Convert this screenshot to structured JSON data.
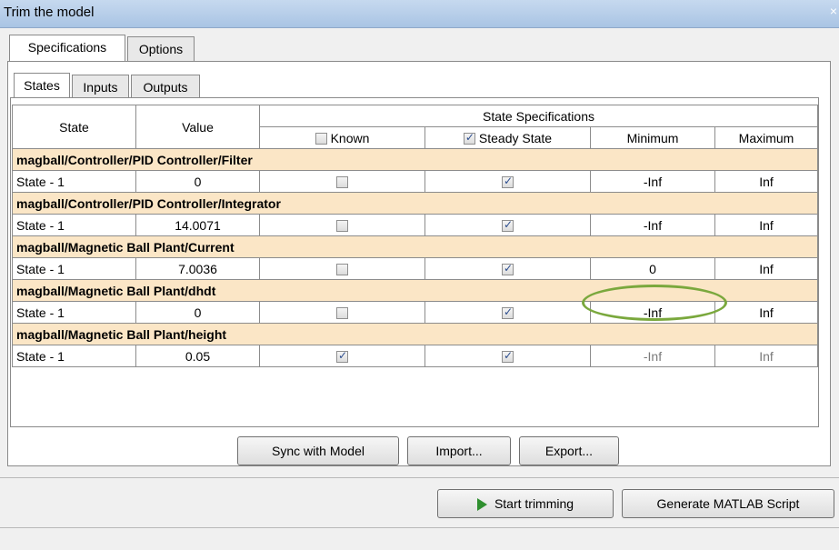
{
  "window": {
    "title": "Trim the model",
    "close_glyph": "×"
  },
  "outer_tabs": [
    "Specifications",
    "Options"
  ],
  "inner_tabs": [
    "States",
    "Inputs",
    "Outputs"
  ],
  "table": {
    "headers": {
      "state": "State",
      "value": "Value",
      "group": "State Specifications",
      "known": "Known",
      "steady": "Steady State",
      "minimum": "Minimum",
      "maximum": "Maximum"
    },
    "header_known_checked": false,
    "header_steady_checked": true,
    "groups": [
      {
        "name": "magball/Controller/PID Controller/Filter",
        "row": {
          "state": "State - 1",
          "value": "0",
          "known": false,
          "steady": true,
          "min": "-Inf",
          "max": "Inf"
        }
      },
      {
        "name": "magball/Controller/PID Controller/Integrator",
        "row": {
          "state": "State - 1",
          "value": "14.0071",
          "known": false,
          "steady": true,
          "min": "-Inf",
          "max": "Inf"
        }
      },
      {
        "name": "magball/Magnetic Ball Plant/Current",
        "row": {
          "state": "State - 1",
          "value": "7.0036",
          "known": false,
          "steady": true,
          "min": "0",
          "max": "Inf"
        }
      },
      {
        "name": "magball/Magnetic Ball Plant/dhdt",
        "row": {
          "state": "State - 1",
          "value": "0",
          "known": false,
          "steady": true,
          "min": "-Inf",
          "max": "Inf"
        }
      },
      {
        "name": "magball/Magnetic Ball Plant/height",
        "row": {
          "state": "State - 1",
          "value": "0.05",
          "known": true,
          "steady": true,
          "min": "-Inf",
          "max": "Inf"
        }
      }
    ]
  },
  "buttons": {
    "sync": "Sync with Model",
    "import": "Import...",
    "export": "Export...",
    "start": "Start trimming",
    "generate": "Generate MATLAB Script"
  },
  "colors": {
    "group_row": "#fbe6c6",
    "highlight": "#7aa83d",
    "play_icon": "#2f8f2f"
  }
}
